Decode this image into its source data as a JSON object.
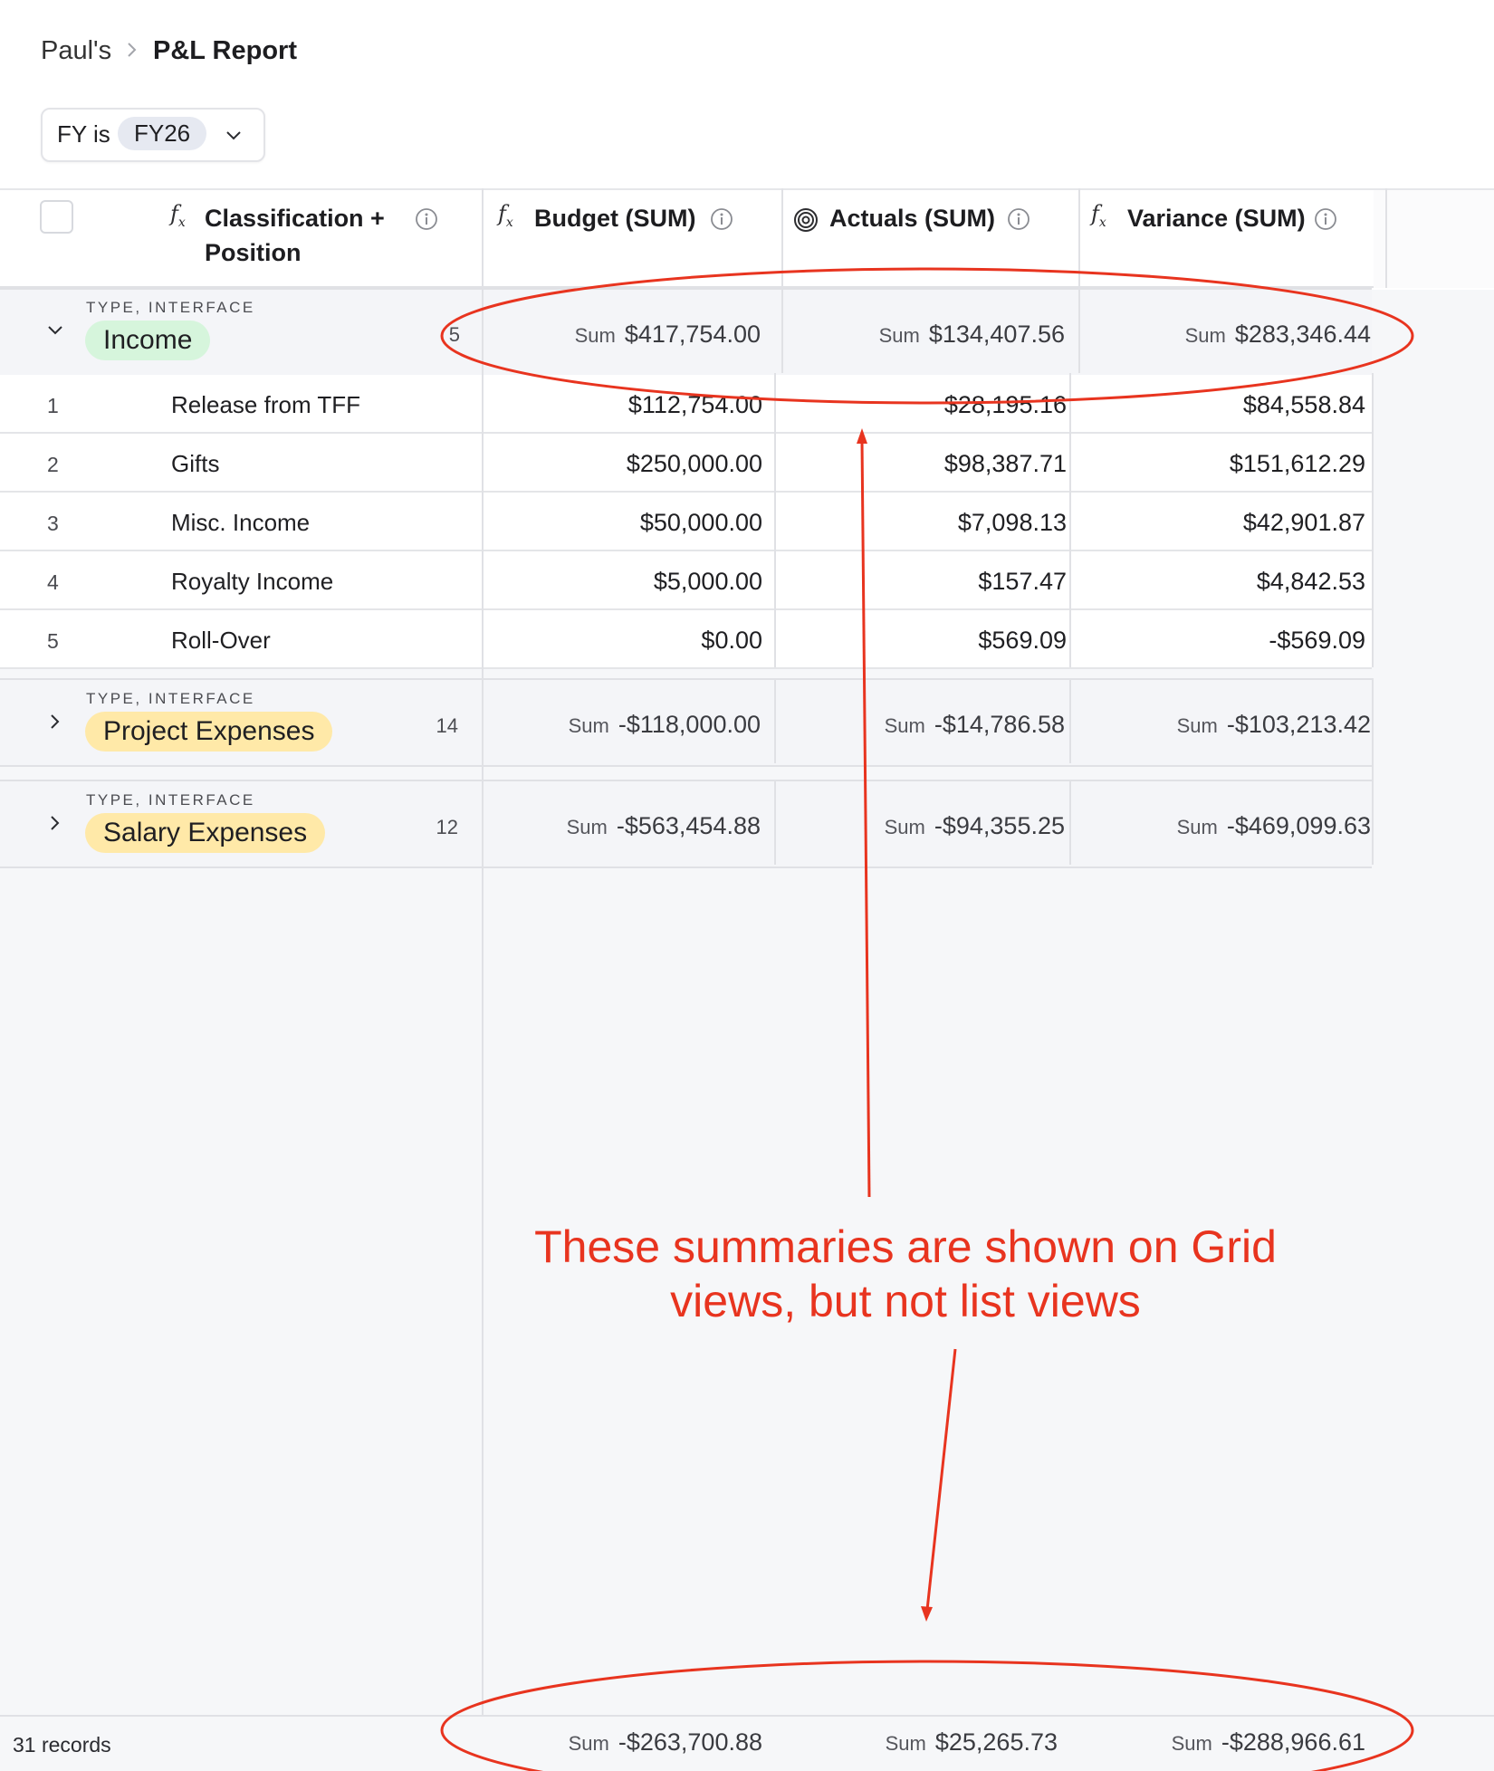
{
  "breadcrumb": {
    "root": "Paul's",
    "current": "P&L Report"
  },
  "filter": {
    "label": "FY is",
    "value": "FY26"
  },
  "columns": {
    "classification_line1": "Classification +",
    "classification_line2": "Position",
    "budget": "Budget (SUM)",
    "actuals": "Actuals (SUM)",
    "variance": "Variance (SUM)"
  },
  "icons": {
    "formula": "formula-icon",
    "rollup": "rollup-icon",
    "info": "info-icon",
    "chevron": "chevron-icon"
  },
  "sum_label": "Sum",
  "groups": [
    {
      "type_label": "TYPE, INTERFACE",
      "name": "Income",
      "count": "5",
      "expanded": true,
      "budget": "$417,754.00",
      "actuals": "$134,407.56",
      "variance": "$283,346.44",
      "rows": [
        {
          "num": "1",
          "name": "Release from TFF",
          "budget": "$112,754.00",
          "actuals": "$28,195.16",
          "variance": "$84,558.84"
        },
        {
          "num": "2",
          "name": "Gifts",
          "budget": "$250,000.00",
          "actuals": "$98,387.71",
          "variance": "$151,612.29"
        },
        {
          "num": "3",
          "name": "Misc. Income",
          "budget": "$50,000.00",
          "actuals": "$7,098.13",
          "variance": "$42,901.87"
        },
        {
          "num": "4",
          "name": "Royalty Income",
          "budget": "$5,000.00",
          "actuals": "$157.47",
          "variance": "$4,842.53"
        },
        {
          "num": "5",
          "name": "Roll-Over",
          "budget": "$0.00",
          "actuals": "$569.09",
          "variance": "-$569.09"
        }
      ]
    },
    {
      "type_label": "TYPE, INTERFACE",
      "name": "Project Expenses",
      "count": "14",
      "expanded": false,
      "budget": "-$118,000.00",
      "actuals": "-$14,786.58",
      "variance": "-$103,213.42"
    },
    {
      "type_label": "TYPE, INTERFACE",
      "name": "Salary Expenses",
      "count": "12",
      "expanded": false,
      "budget": "-$563,454.88",
      "actuals": "-$94,355.25",
      "variance": "-$469,099.63"
    }
  ],
  "footer": {
    "records": "31 records",
    "budget": "-$263,700.88",
    "actuals": "$25,265.73",
    "variance": "-$288,966.61"
  },
  "annotation": {
    "text_line1": "These summaries are shown on Grid",
    "text_line2": "views, but not list views",
    "color": "#e8341f"
  },
  "colors": {
    "income_pill": "#d6f5dc",
    "expense_pill": "#ffe9a8",
    "annotation": "#e8341f"
  }
}
